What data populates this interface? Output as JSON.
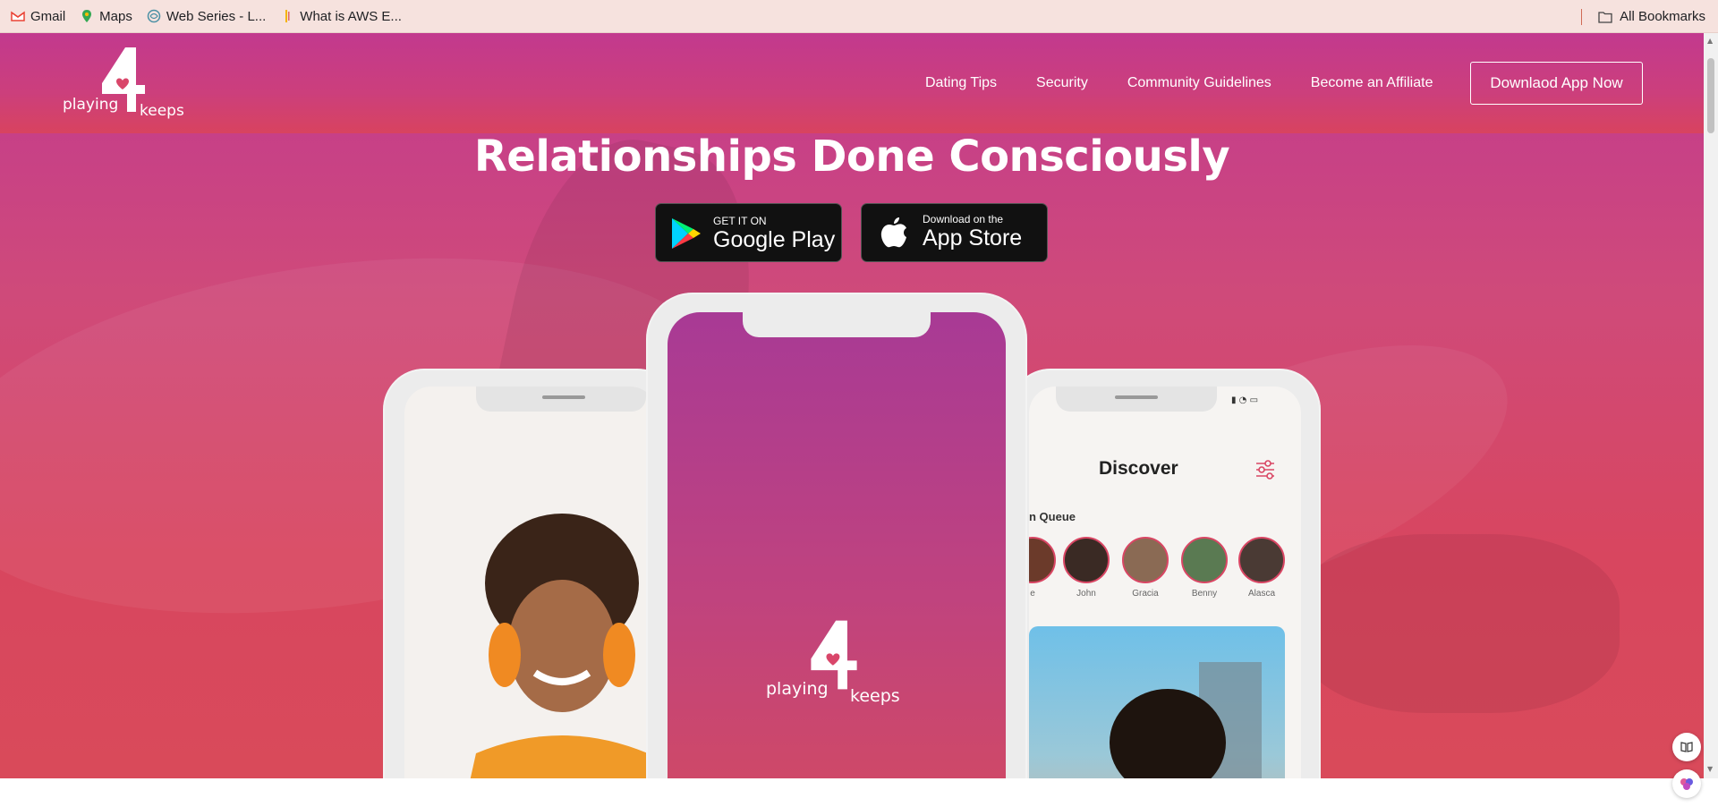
{
  "bookmarks": {
    "items": [
      {
        "label": "Gmail",
        "icon": "gmail-icon"
      },
      {
        "label": "Maps",
        "icon": "maps-icon"
      },
      {
        "label": "Web Series - L...",
        "icon": "web-icon"
      },
      {
        "label": "What is AWS E...",
        "icon": "bookmark-icon"
      }
    ],
    "all_bookmarks": "All Bookmarks"
  },
  "header": {
    "logo_word1": "playing",
    "logo_word2": "keeps",
    "nav": [
      "Dating Tips",
      "Security",
      "Community Guidelines",
      "Become an Affiliate"
    ],
    "cta": "Downlaod App Now"
  },
  "hero": {
    "title": "Relationships Done Consciously",
    "google_play_small": "GET IT ON",
    "google_play_big": "Google Play",
    "app_store_small": "Download on the",
    "app_store_big": "App Store"
  },
  "phone_center": {
    "logo_word1": "playing",
    "logo_word2": "keeps"
  },
  "phone_right": {
    "title": "Discover",
    "queue_label": "n Queue",
    "queue": [
      "e",
      "John",
      "Gracia",
      "Benny",
      "Alasca"
    ]
  },
  "colors": {
    "brand_pink": "#c83c86",
    "brand_red": "#d94664"
  }
}
